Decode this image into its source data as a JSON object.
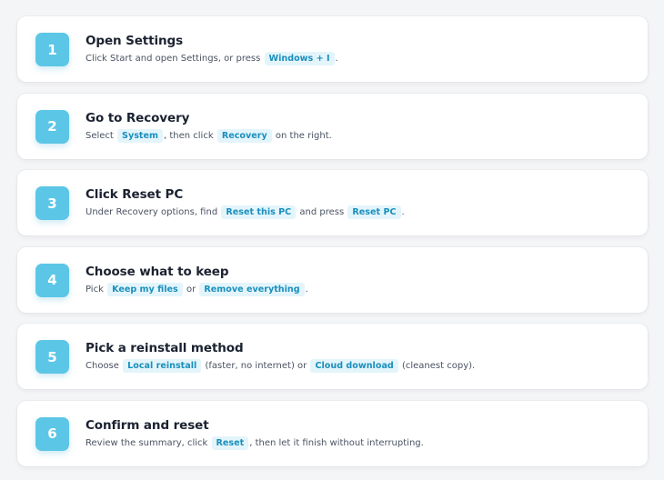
{
  "colors": {
    "accent": "#5cc6e6",
    "chip_bg": "#e3f5fb",
    "chip_text": "#1a8fbd",
    "title_text": "#1b2230",
    "desc_text": "#4a5262",
    "background": "#f4f5f7"
  },
  "steps": [
    {
      "number": "1",
      "title": "Open Settings",
      "parts": [
        {
          "text": "Click Start and open Settings, or press "
        },
        {
          "chip": "Windows + I"
        },
        {
          "text": "."
        }
      ]
    },
    {
      "number": "2",
      "title": "Go to Recovery",
      "parts": [
        {
          "text": "Select "
        },
        {
          "chip": "System"
        },
        {
          "text": ", then click "
        },
        {
          "chip": "Recovery"
        },
        {
          "text": " on the right."
        }
      ]
    },
    {
      "number": "3",
      "title": "Click Reset PC",
      "parts": [
        {
          "text": "Under Recovery options, find "
        },
        {
          "chip": "Reset this PC"
        },
        {
          "text": " and press "
        },
        {
          "chip": "Reset PC"
        },
        {
          "text": "."
        }
      ]
    },
    {
      "number": "4",
      "title": "Choose what to keep",
      "parts": [
        {
          "text": "Pick "
        },
        {
          "chip": "Keep my files"
        },
        {
          "text": " or "
        },
        {
          "chip": "Remove everything"
        },
        {
          "text": "."
        }
      ]
    },
    {
      "number": "5",
      "title": "Pick a reinstall method",
      "parts": [
        {
          "text": "Choose "
        },
        {
          "chip": "Local reinstall"
        },
        {
          "text": " (faster, no internet) or "
        },
        {
          "chip": "Cloud download"
        },
        {
          "text": " (cleanest copy)."
        }
      ]
    },
    {
      "number": "6",
      "title": "Confirm and reset",
      "parts": [
        {
          "text": "Review the summary, click "
        },
        {
          "chip": "Reset"
        },
        {
          "text": ", then let it finish without interrupting."
        }
      ]
    }
  ]
}
